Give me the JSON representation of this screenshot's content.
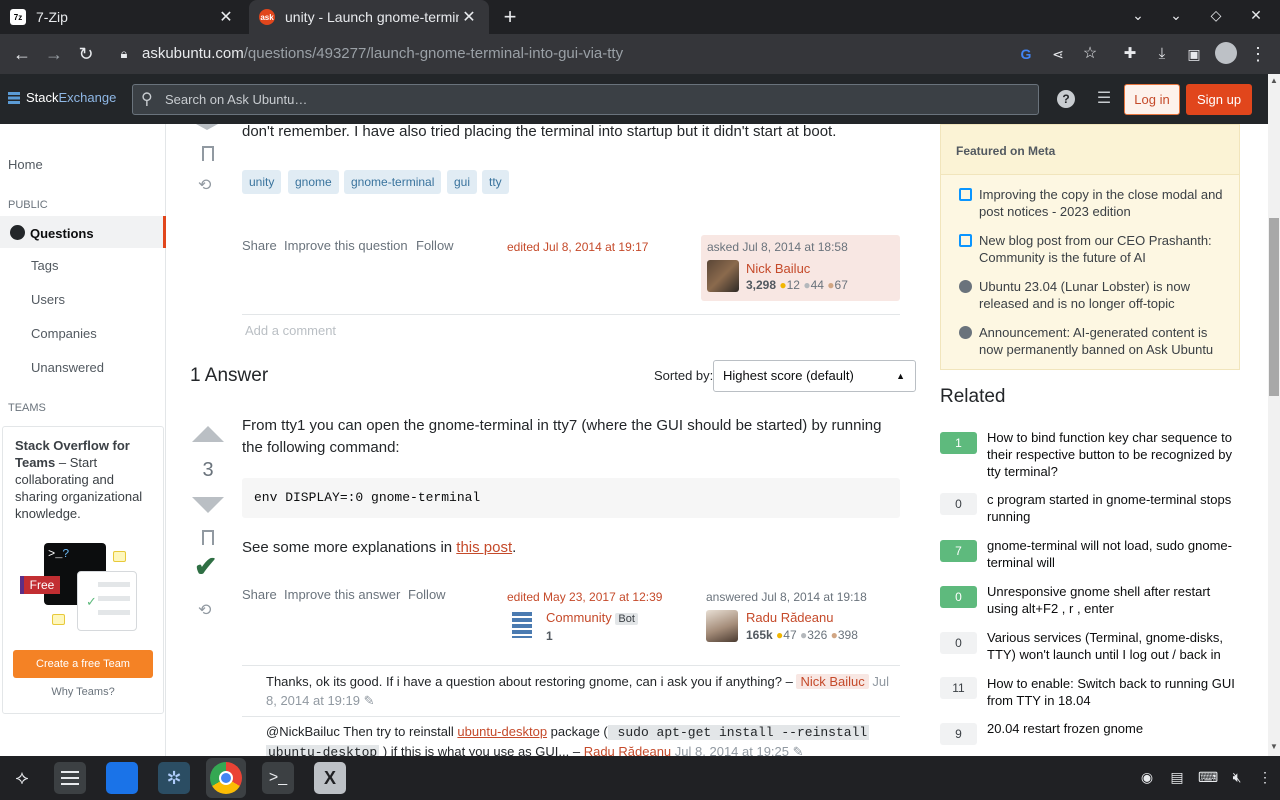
{
  "browser": {
    "tabs": [
      {
        "title": "7-Zip",
        "active": false
      },
      {
        "title": "unity - Launch gnome-termin",
        "active": true
      }
    ],
    "url_domain": "askubuntu.com",
    "url_path": "/questions/493277/launch-gnome-terminal-into-gui-via-tty"
  },
  "header": {
    "logo_part1": "Stack",
    "logo_part2": "Exchange",
    "search_placeholder": "Search on Ask Ubuntu…",
    "login_label": "Log in",
    "signup_label": "Sign up"
  },
  "leftnav": {
    "home": "Home",
    "public_label": "PUBLIC",
    "questions": "Questions",
    "tags": "Tags",
    "users": "Users",
    "companies": "Companies",
    "unanswered": "Unanswered",
    "teams_label": "TEAMS",
    "teams_title": "Stack Overflow for Teams",
    "teams_text": " – Start collaborating and sharing organizational knowledge.",
    "free_badge": "Free",
    "create_team": "Create a free Team",
    "why_teams": "Why Teams?"
  },
  "question": {
    "body_tail": "don't remember. I have also tried placing the terminal into startup but it didn't start at boot.",
    "tags": [
      "unity",
      "gnome",
      "gnome-terminal",
      "gui",
      "tty"
    ],
    "share": "Share",
    "improve": "Improve this question",
    "follow": "Follow",
    "edited": "edited Jul 8, 2014 at 19:17",
    "asked": "asked Jul 8, 2014 at 18:58",
    "user": "Nick Bailuc",
    "rep": "3,298",
    "gold": "12",
    "silver": "44",
    "bronze": "67",
    "add_comment": "Add a comment"
  },
  "answers": {
    "count_label": "1 Answer",
    "sorted_by": "Sorted by:",
    "sort_value": "Highest score (default)"
  },
  "answer": {
    "score": "3",
    "text1": "From tty1 you can open the gnome-terminal in tty7 (where the GUI should be started) by running the following command:",
    "code": "env DISPLAY=:0 gnome-terminal",
    "text2_prefix": "See some more explanations in ",
    "text2_link": "this post",
    "text2_suffix": ".",
    "share": "Share",
    "improve": "Improve this answer",
    "follow": "Follow",
    "edited": "edited May 23, 2017 at 12:39",
    "editor": "Community",
    "editor_badge": "Bot",
    "editor_rep": "1",
    "answered": "answered Jul 8, 2014 at 19:18",
    "user": "Radu Rădeanu",
    "rep": "165k",
    "gold": "47",
    "silver": "326",
    "bronze": "398"
  },
  "comments": [
    {
      "text": "Thanks, ok its good. If i have a question about restoring gnome, can i ask you if anything? –",
      "user": "Nick Bailuc",
      "date": "Jul 8, 2014 at 19:19"
    },
    {
      "prefix": "@NickBailuc Then try to reinstall ",
      "link": "ubuntu-desktop",
      "mid": " package (",
      "code1": " sudo apt-get install --reinstall",
      "code2": "ubuntu-desktop",
      "suffix": " ) if this is what you use as GUI... –",
      "user": "Radu Rădeanu",
      "date": "Jul 8, 2014 at 19:25"
    }
  ],
  "meta": {
    "heading": "Featured on Meta",
    "items": [
      "Improving the copy in the close modal and post notices - 2023 edition",
      "New blog post from our CEO Prashanth: Community is the future of AI",
      "Ubuntu 23.04 (Lunar Lobster) is now released and is no longer off-topic",
      "Announcement: AI-generated content is now permanently banned on Ask Ubuntu"
    ]
  },
  "related": {
    "heading": "Related",
    "items": [
      {
        "score": "1",
        "title": "How to bind function key char sequence to their respective button to be recognized by tty terminal?"
      },
      {
        "score": "0",
        "title": "c program started in gnome-terminal stops running"
      },
      {
        "score": "7",
        "title": "gnome-terminal will not load, sudo gnome-terminal will"
      },
      {
        "score": "0",
        "title": "Unresponsive gnome shell after restart using alt+F2 , r , enter"
      },
      {
        "score": "0",
        "title": "Various services (Terminal, gnome-disks, TTY) won't launch until I log out / back in"
      },
      {
        "score": "11",
        "title": "How to enable: Switch back to running GUI from TTY in 18.04"
      },
      {
        "score": "9",
        "title": "20.04 restart frozen gnome"
      }
    ]
  },
  "colors": {
    "accent": "#e1461c",
    "link": "#c54a2a",
    "vote_accepted": "#2f6f44"
  }
}
